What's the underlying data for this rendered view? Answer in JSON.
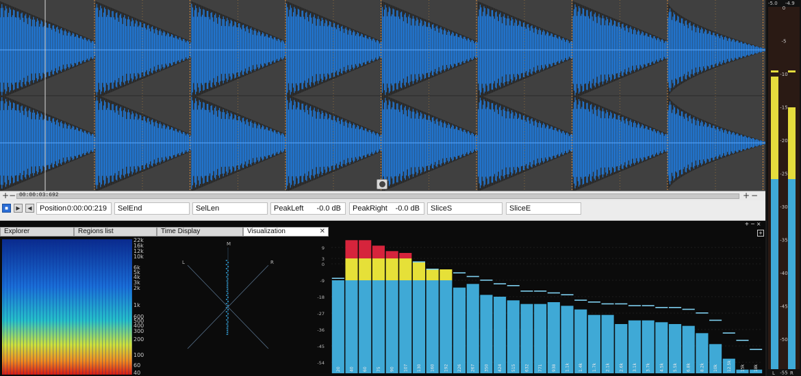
{
  "ruler": {
    "time": "00:00:03:692",
    "left_plus": "+",
    "left_minus": "−",
    "right_plus": "+",
    "right_minus": "−"
  },
  "status": {
    "fields": [
      {
        "label": "Position",
        "value": "0:00:00:219"
      },
      {
        "label": "SelEnd",
        "value": ""
      },
      {
        "label": "SelLen",
        "value": ""
      },
      {
        "label": "PeakLeft",
        "value": "-0.0 dB"
      },
      {
        "label": "PeakRight",
        "value": "-0.0 dB"
      },
      {
        "label": "SliceS",
        "value": ""
      },
      {
        "label": "SliceE",
        "value": ""
      }
    ]
  },
  "tabs": [
    "Explorer",
    "Regions list",
    "Time Display",
    "Visualization"
  ],
  "active_tab": "Visualization",
  "spectrogram": {
    "freq_labels": [
      "22k",
      "16k",
      "12k",
      "10k",
      "6k",
      "5k",
      "4k",
      "3k",
      "2k",
      "1k",
      "600",
      "500",
      "400",
      "300",
      "200",
      "100",
      "60",
      "40"
    ]
  },
  "scope": {
    "labels": {
      "mid": "M",
      "left": "L",
      "right": "R"
    }
  },
  "master_meter": {
    "top_labels": [
      "-5.0",
      "-4.9"
    ],
    "scale": [
      "0",
      "-5",
      "-10",
      "-15",
      "-20",
      "-25",
      "-30",
      "-35",
      "-40",
      "-45",
      "-50",
      "-55"
    ],
    "channel_labels": [
      "L",
      "R"
    ]
  },
  "chart_data": {
    "type": "bar",
    "title": "",
    "ylabel": "",
    "ylim": [
      -60,
      12
    ],
    "yticks": [
      9,
      3,
      0,
      -9,
      -18,
      -27,
      -36,
      -45,
      -54
    ],
    "categories": [
      "20",
      "40",
      "60",
      "75",
      "90",
      "107",
      "130",
      "160",
      "192",
      "226",
      "267",
      "350",
      "424",
      "515",
      "632",
      "771",
      "938",
      "1.1k",
      "1.4k",
      "1.7k",
      "2.1k",
      "2.6k",
      "3.1k",
      "3.7k",
      "4.5k",
      "5.5k",
      "6.8k",
      "8.2k",
      "10k",
      "12.5k",
      "15k",
      "18k"
    ],
    "series": [
      {
        "values": [
          -9,
          13,
          13,
          10,
          7,
          6,
          1,
          -3,
          -3,
          -13,
          -11,
          -17,
          -18,
          -20,
          -22,
          -22,
          -21,
          -23,
          -25,
          -28,
          -28,
          -33,
          -31,
          -31,
          -32,
          -33,
          -34,
          -38,
          -44,
          -52,
          -58,
          -58
        ]
      }
    ],
    "peaks": [
      -8,
      9,
      9,
      6,
      4,
      2,
      1,
      -3,
      -4,
      -5,
      -7,
      -9,
      -11,
      -12,
      -15,
      -15,
      -16,
      -17,
      -20,
      -21,
      -22,
      -22,
      -23,
      -23,
      -24,
      -24,
      -25,
      -27,
      -31,
      -38,
      -42,
      -47
    ],
    "colors": {
      "bar": "#3fa9d6",
      "mid": "#e6e038",
      "hot": "#d6243c",
      "peak": "#7fd0f0"
    }
  },
  "colors": {
    "wave": "#1e82ee",
    "wave_bg": "#404040",
    "accent": "#1e82ee"
  }
}
